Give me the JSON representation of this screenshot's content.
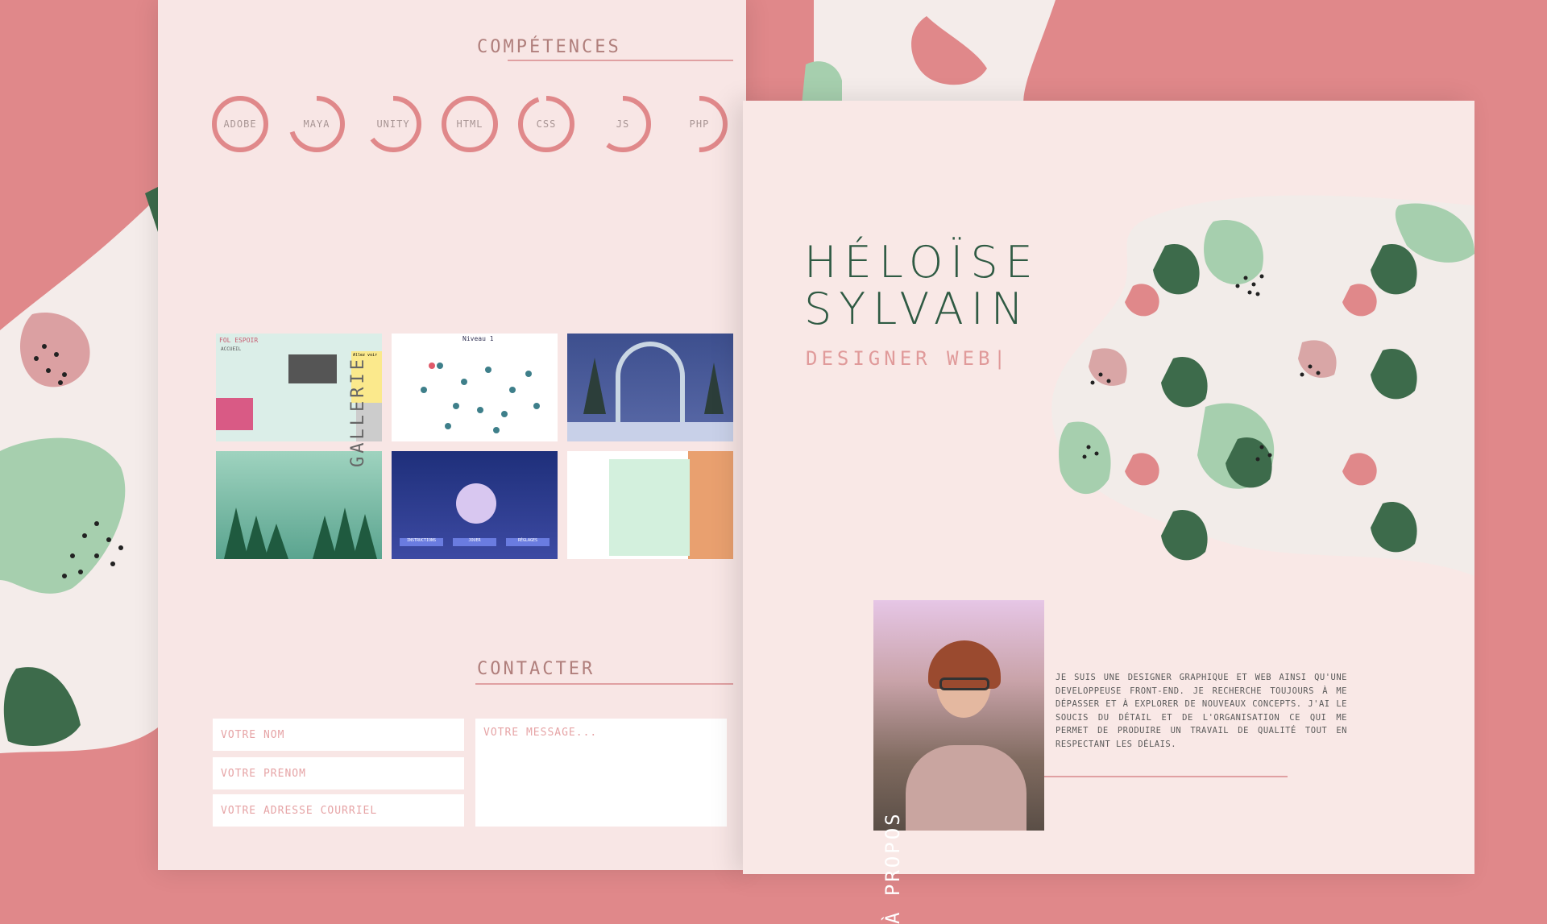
{
  "portfolio": {
    "name_line1": "HÉLOÏSE",
    "name_line2": "SYLVAIN",
    "role": "DESIGNER WEB|",
    "about_label": "À PROPOS",
    "bio": "JE SUIS UNE DESIGNER GRAPHIQUE ET WEB AINSI QU'UNE DEVELOPPEUSE FRONT-END. JE RECHERCHE TOUJOURS À ME DÉPASSER ET À EXPLORER DE NOUVEAUX CONCEPTS. J'AI LE SOUCIS DU DÉTAIL ET DE L'ORGANISATION CE QUI ME PERMET DE PRODUIRE UN TRAVAIL DE QUALITÉ TOUT EN RESPECTANT LES DÉLAIS."
  },
  "skills": {
    "title": "COMPÉTENCES",
    "items": [
      {
        "label": "ADOBE",
        "level": 1.0
      },
      {
        "label": "MAYA",
        "level": 0.7
      },
      {
        "label": "UNITY",
        "level": 0.65
      },
      {
        "label": "HTML",
        "level": 1.0
      },
      {
        "label": "CSS",
        "level": 0.95
      },
      {
        "label": "JS",
        "level": 0.6
      },
      {
        "label": "PHP",
        "level": 0.5
      }
    ]
  },
  "gallery": {
    "title": "GALLERIE",
    "thumb1": {
      "header": "FOL ESPOIR",
      "sub": "ACCUEIL",
      "box": "Allez voir"
    },
    "thumb2": {
      "title": "Niveau 1"
    },
    "thumb5": {
      "btn1": "INSTRUCTIONS",
      "btn2": "JOUER",
      "btn3": "RÉGLAGES"
    }
  },
  "contact": {
    "title": "CONTACTER",
    "name_placeholder": "VOTRE NOM",
    "firstname_placeholder": "VOTRE PRÉNOM",
    "email_placeholder": "VOTRE ADRESSE COURRIEL",
    "message_placeholder": "VOTRE MESSAGE..."
  },
  "colors": {
    "background": "#e0888a",
    "page": "#f8e6e5",
    "accent_pink": "#e0888a",
    "dark_green": "#3d6b4b",
    "light_green": "#a6cfae"
  }
}
